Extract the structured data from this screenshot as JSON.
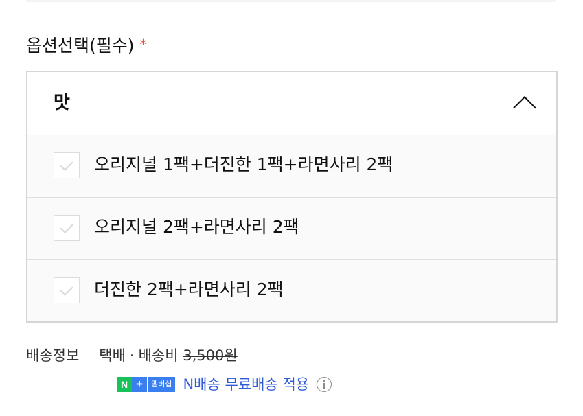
{
  "option_section": {
    "title": "옵션선택(필수)",
    "required_mark": "*",
    "dropdown": {
      "label": "맛",
      "expanded": true,
      "toggle_icon": "chevron-up-icon"
    },
    "options": [
      {
        "label": "오리지널 1팩+더진한 1팩+라면사리 2팩",
        "checked": false
      },
      {
        "label": "오리지널 2팩+라면사리 2팩",
        "checked": false
      },
      {
        "label": "더진한 2팩+라면사리 2팩",
        "checked": false
      }
    ]
  },
  "shipping": {
    "label": "배송정보",
    "method": "택배",
    "separator": "·",
    "fee_label": "배송비",
    "fee_original": "3,500원"
  },
  "membership": {
    "badge_n": "N",
    "badge_plus": "+",
    "badge_text": "멤버십",
    "text": "N배송 무료배송 적용",
    "info_icon": "info-icon"
  },
  "colors": {
    "required": "#e8513b",
    "npay_green": "#19c15a",
    "membership_blue": "#3a7ff0",
    "membership_text": "#2f5bd9"
  }
}
